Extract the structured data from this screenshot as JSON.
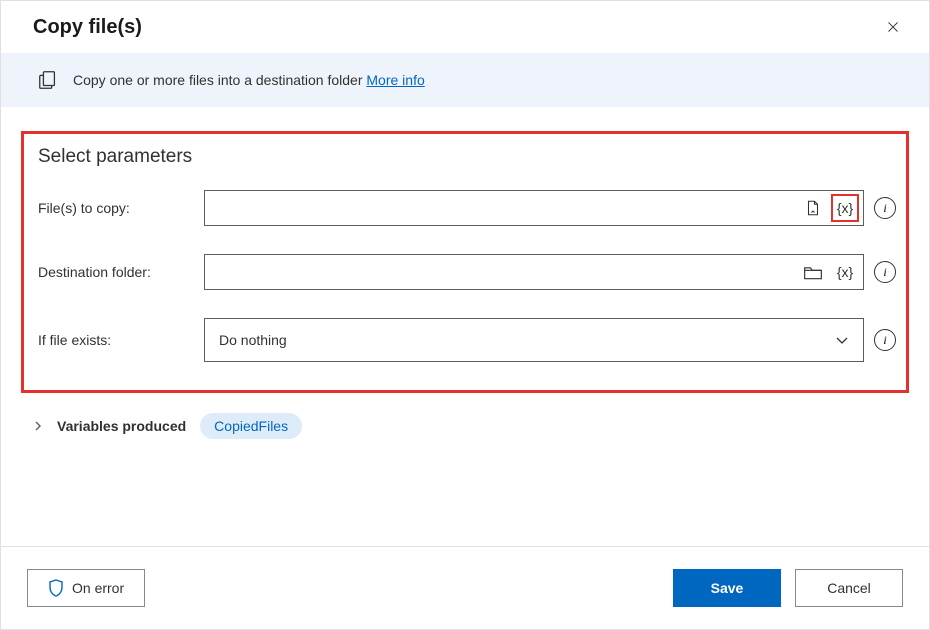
{
  "dialog": {
    "title": "Copy file(s)"
  },
  "info": {
    "text": "Copy one or more files into a destination folder ",
    "link_label": "More info"
  },
  "params": {
    "section_title": "Select parameters",
    "files_label": "File(s) to copy:",
    "files_value": "",
    "dest_label": "Destination folder:",
    "dest_value": "",
    "exists_label": "If file exists:",
    "exists_value": "Do nothing"
  },
  "variables": {
    "label": "Variables produced",
    "chip": "CopiedFiles"
  },
  "footer": {
    "on_error": "On error",
    "save": "Save",
    "cancel": "Cancel"
  }
}
